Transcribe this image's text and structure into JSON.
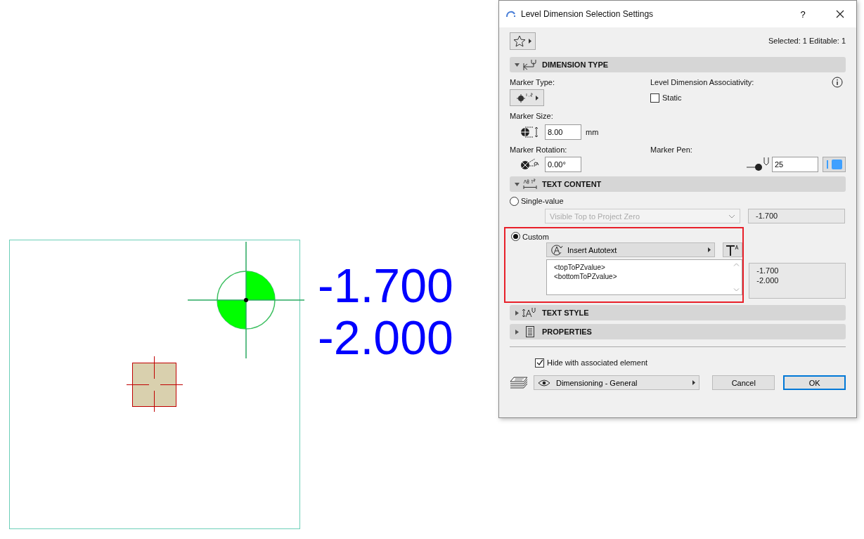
{
  "canvas": {
    "labels": [
      "-1.700",
      "-2.000"
    ]
  },
  "dialog": {
    "title": "Level Dimension Selection Settings",
    "help": "?",
    "selection_info": "Selected: 1 Editable: 1",
    "dimension_type": {
      "title": "DIMENSION TYPE",
      "expanded": true,
      "marker_type_label": "Marker Type:",
      "associativity_label": "Level Dimension Associativity:",
      "static": {
        "label": "Static",
        "checked": false
      },
      "marker_size_label": "Marker Size:",
      "marker_size": "8.00",
      "unit": "mm",
      "marker_rotation_label": "Marker Rotation:",
      "marker_rotation": "0.00°",
      "marker_pen_label": "Marker Pen:",
      "marker_pen": "25"
    },
    "text_content": {
      "title": "TEXT CONTENT",
      "expanded": true,
      "single_value": {
        "label": "Single-value",
        "selected": false,
        "dropdown": "Visible Top to Project Zero",
        "disabled": true,
        "preview": "-1.700"
      },
      "custom": {
        "label": "Custom",
        "selected": true,
        "highlighted": true,
        "autotext_button": "Insert Autotext",
        "lines": [
          "<topToPZvalue>",
          "<bottomToPZvalue>"
        ],
        "preview": [
          "-1.700",
          "-2.000"
        ]
      }
    },
    "collapsed_sections": [
      {
        "kind": "text_style",
        "title": "TEXT STYLE",
        "expanded": false
      },
      {
        "kind": "properties",
        "title": "PROPERTIES",
        "expanded": false
      }
    ],
    "hide_with_element": {
      "label": "Hide with associated element",
      "checked": true
    },
    "layer": "Dimensioning - General",
    "buttons": [
      {
        "label": "Cancel",
        "default": false
      },
      {
        "label": "OK",
        "default": true
      }
    ]
  }
}
